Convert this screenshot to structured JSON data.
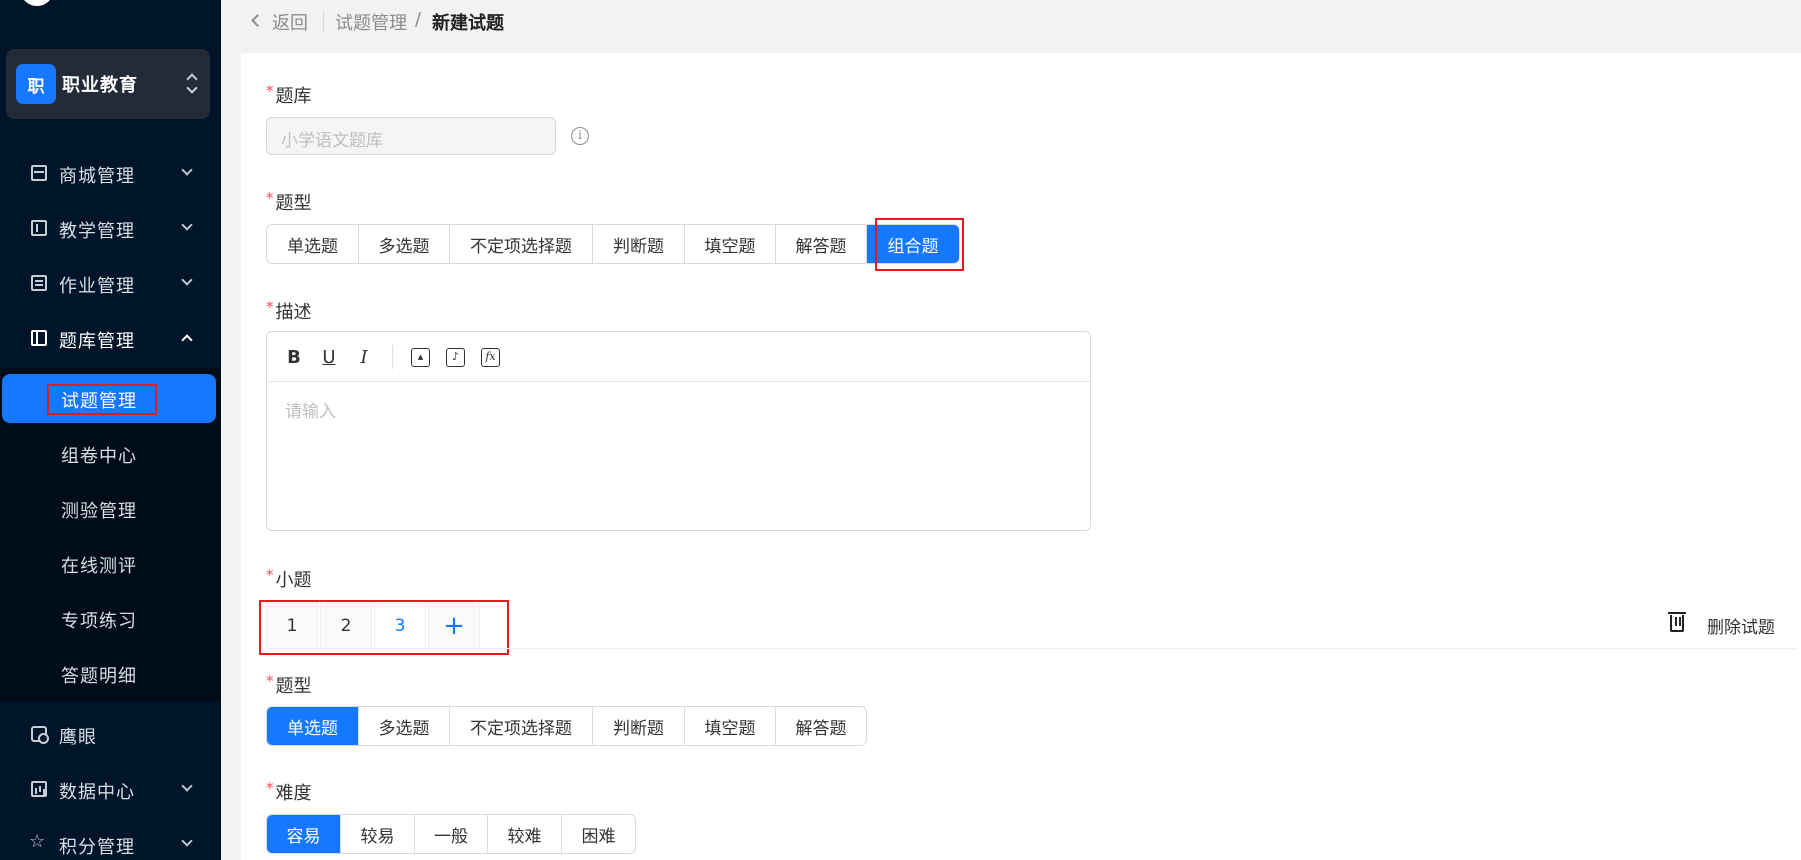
{
  "org": {
    "badge": "职",
    "name": "职业教育"
  },
  "sidebar": {
    "menu": [
      {
        "label": "商城管理",
        "icon": "shop-icon"
      },
      {
        "label": "教学管理",
        "icon": "book-icon"
      },
      {
        "label": "作业管理",
        "icon": "document-icon"
      },
      {
        "label": "题库管理",
        "icon": "library-icon",
        "expanded": true
      },
      {
        "label": "鹰眼",
        "icon": "eye-monitor-icon"
      },
      {
        "label": "数据中心",
        "icon": "chart-icon"
      },
      {
        "label": "积分管理",
        "icon": "star-icon"
      }
    ],
    "submenu": [
      "试题管理",
      "组卷中心",
      "测验管理",
      "在线测评",
      "专项练习",
      "答题明细"
    ],
    "active_submenu": "试题管理"
  },
  "breadcrumb": {
    "back": "返回",
    "parent": "试题管理",
    "separator": "/",
    "current": "新建试题"
  },
  "form": {
    "bank": {
      "label": "题库",
      "placeholder": "小学语文题库",
      "info_icon": "i"
    },
    "type": {
      "label": "题型",
      "options": [
        "单选题",
        "多选题",
        "不定项选择题",
        "判断题",
        "填空题",
        "解答题",
        "组合题"
      ],
      "selected": "组合题"
    },
    "description": {
      "label": "描述",
      "toolbar": [
        "B",
        "U",
        "I",
        "image",
        "audio",
        "formula"
      ],
      "toolbar_glyphs": {
        "bold": "B",
        "underline": "U",
        "italic": "I",
        "formula": "fx"
      },
      "placeholder": "请输入"
    },
    "subquestions": {
      "label": "小题",
      "tabs": [
        "1",
        "2",
        "3"
      ],
      "active": "3",
      "add": "+",
      "delete_label": "删除试题"
    },
    "sub_type": {
      "label": "题型",
      "options": [
        "单选题",
        "多选题",
        "不定项选择题",
        "判断题",
        "填空题",
        "解答题"
      ],
      "selected": "单选题"
    },
    "difficulty": {
      "label": "难度",
      "options": [
        "容易",
        "较易",
        "一般",
        "较难",
        "困难"
      ],
      "selected": "容易"
    }
  },
  "colors": {
    "primary": "#1677ff",
    "sidebar": "#001529",
    "highlight": "#e31b1b",
    "required": "#ff4d4f"
  }
}
